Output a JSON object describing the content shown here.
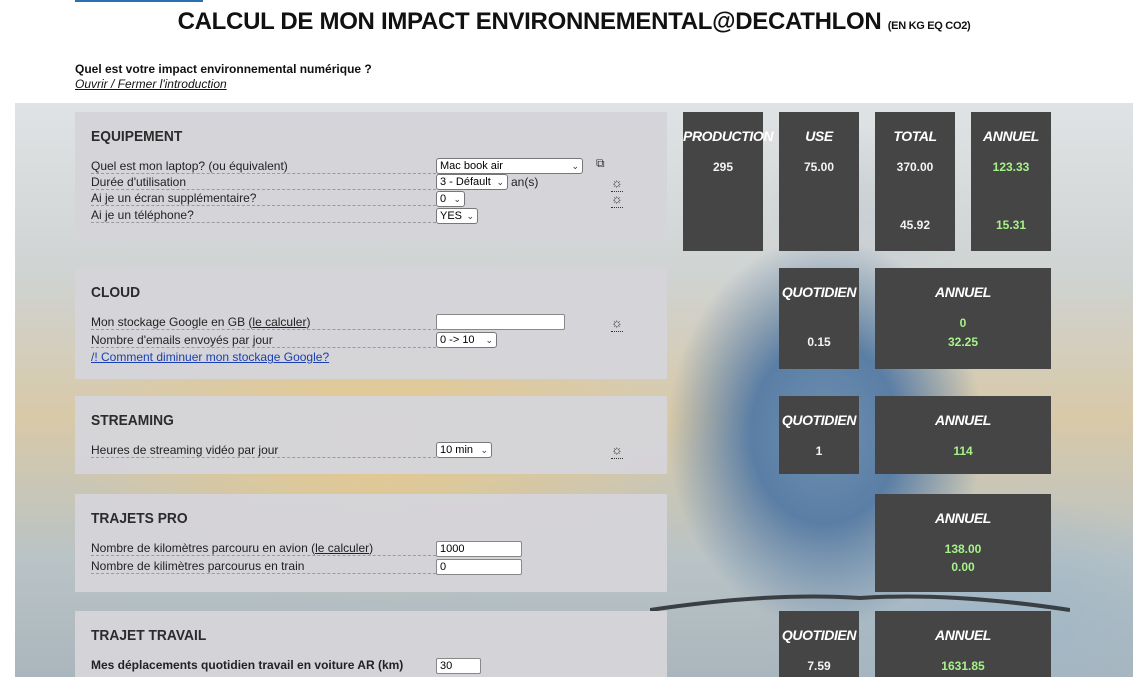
{
  "header": {
    "title": "CALCUL DE MON IMPACT ENVIRONNEMENTAL@DECATHLON",
    "unit": "(EN KG EQ CO2)",
    "question": "Quel est votre impact environnemental numérique ?",
    "toggle_link": "Ouvrir / Fermer l'introduction"
  },
  "equipement": {
    "title": "EQUIPEMENT",
    "laptop_label": "Quel est mon laptop? (ou équivalent)",
    "laptop_value": "Mac book air",
    "duration_label": "Durée d'utilisation",
    "duration_value": "3 - Défault",
    "duration_unit": "an(s)",
    "screen_label": "Ai je un écran supplémentaire?",
    "screen_value": "0",
    "phone_label": "Ai je un téléphone?",
    "phone_value": "YES",
    "results": {
      "production_header": "PRODUCTION",
      "use_header": "USE",
      "total_header": "TOTAL",
      "annuel_header": "ANNUEL",
      "production_value": "295",
      "use_value": "75.00",
      "total_laptop": "370.00",
      "annuel_laptop": "123.33",
      "total_phone": "45.92",
      "annuel_phone": "15.31"
    }
  },
  "cloud": {
    "title": "CLOUD",
    "storage_label": "Mon stockage Google en GB (",
    "storage_link": "le calculer",
    "storage_close": ")",
    "storage_value": "",
    "emails_label": "Nombre d'emails envoyés par jour",
    "emails_value": "0 -> 10",
    "help_link": "/! Comment diminuer mon stockage Google?",
    "results": {
      "quotidien_header": "QUOTIDIEN",
      "annuel_header": "ANNUEL",
      "quotidien_value": "0.15",
      "annuel_storage": "0",
      "annuel_emails": "32.25"
    }
  },
  "streaming": {
    "title": "STREAMING",
    "hours_label": "Heures de streaming vidéo par jour",
    "hours_value": "10 min",
    "results": {
      "quotidien_header": "QUOTIDIEN",
      "annuel_header": "ANNUEL",
      "quotidien_value": "1",
      "annuel_value": "114"
    }
  },
  "trajets_pro": {
    "title": "TRAJETS PRO",
    "plane_label": "Nombre de kilomètres parcouru en avion (",
    "plane_link": "le calculer",
    "plane_close": ")",
    "plane_value": "1000",
    "train_label": "Nombre de kilimètres parcourus en train",
    "train_value": "0",
    "results": {
      "annuel_header": "ANNUEL",
      "annuel_plane": "138.00",
      "annuel_train": "0.00"
    }
  },
  "trajet_travail": {
    "title": "TRAJET TRAVAIL",
    "car_label": "Mes déplacements quotidien travail en voiture AR (km)",
    "car_value": "30",
    "results": {
      "quotidien_header": "QUOTIDIEN",
      "annuel_header": "ANNUEL",
      "quotidien_value": "7.59",
      "annuel_value": "1631.85"
    }
  },
  "colors": {
    "panel_bg": "#d5d4d9",
    "result_bg": "#454545",
    "green_value": "#a6f28a",
    "link_blue": "#1a3fb0"
  },
  "icons": [
    "external-link-icon",
    "lightbulb-icon",
    "chevron-down-icon"
  ]
}
